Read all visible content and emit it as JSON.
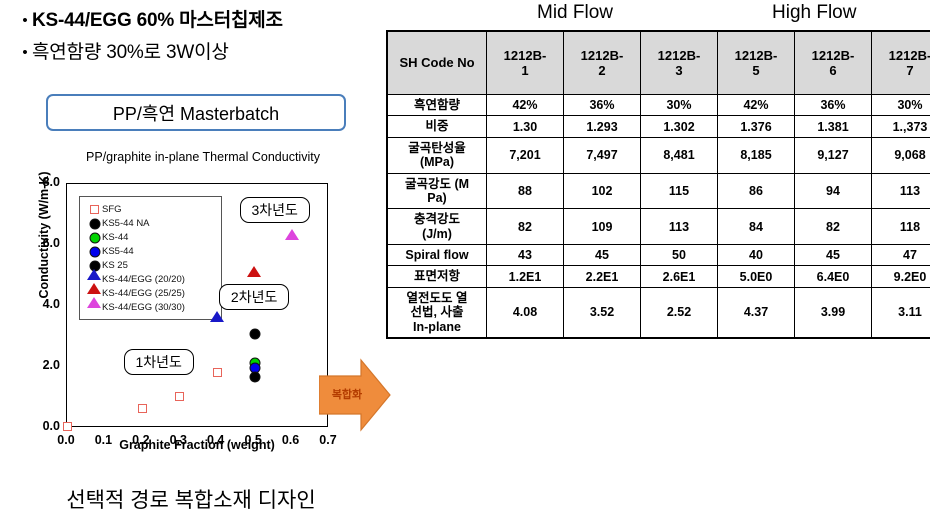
{
  "slide": {
    "bullets": [
      "KS-44/EGG 60% 마스터칩제조",
      "흑연함량 30%로 3W이상"
    ],
    "masterbatch_box": "PP/흑연 Masterbatch",
    "caption": "선택적 경로 복합소재 디자인",
    "arrow_label": "복합화",
    "accent_blue": "#1414cc",
    "box_border_blue": "#4a7ebb",
    "arrow_color": "#ef8c3c",
    "header_bg": "#d9d9d9"
  },
  "chart_data": {
    "type": "scatter",
    "title": "PP/graphite in-plane Thermal Conductivity",
    "xlabel": "Graphite Fraction (weight)",
    "ylabel": "Conductivity (W/m-K)",
    "xlim": [
      0.0,
      0.7
    ],
    "ylim": [
      0.0,
      8.0
    ],
    "xticks": [
      "0.0",
      "0.1",
      "0.2",
      "0.3",
      "0.4",
      "0.5",
      "0.6",
      "0.7"
    ],
    "yticks": [
      "0.0",
      "2.0",
      "4.0",
      "6.0",
      "8.0"
    ],
    "grid": false,
    "legend_position": "top-left",
    "series": [
      {
        "name": "SFG",
        "marker": "open-square",
        "color": "#e8645a",
        "points": [
          [
            0.0,
            0.05
          ],
          [
            0.2,
            0.65
          ],
          [
            0.3,
            1.05
          ],
          [
            0.4,
            1.85
          ]
        ]
      },
      {
        "name": "KS5-44 NA",
        "marker": "circle",
        "color": "#000000",
        "points": [
          [
            0.5,
            3.1
          ]
        ]
      },
      {
        "name": "KS-44",
        "marker": "circle",
        "color": "#00d400",
        "points": [
          [
            0.5,
            2.15
          ]
        ]
      },
      {
        "name": "KS5-44",
        "marker": "circle",
        "color": "#0000ee",
        "points": [
          [
            0.5,
            2.0
          ]
        ]
      },
      {
        "name": "KS 25",
        "marker": "circle",
        "color": "#000000",
        "points": [
          [
            0.5,
            1.72
          ]
        ]
      },
      {
        "name": "KS-44/EGG (20/20)",
        "marker": "triangle",
        "color": "#1818c8",
        "points": [
          [
            0.4,
            3.5
          ]
        ]
      },
      {
        "name": "KS-44/EGG (25/25)",
        "marker": "triangle",
        "color": "#cc1111",
        "points": [
          [
            0.5,
            5.0
          ]
        ]
      },
      {
        "name": "KS-44/EGG (30/30)",
        "marker": "triangle",
        "color": "#dd44dd",
        "points": [
          [
            0.6,
            6.2
          ]
        ]
      }
    ],
    "annotations": [
      {
        "text": "3차년도",
        "x": 0.555,
        "y": 7.15
      },
      {
        "text": "2차년도",
        "x": 0.5,
        "y": 4.3
      },
      {
        "text": "1차년도",
        "x": 0.245,
        "y": 2.15
      }
    ]
  },
  "table": {
    "flow_labels": {
      "mid": "Mid  Flow",
      "high": "High Flow"
    },
    "header": {
      "row_label": "SH Code No",
      "columns": [
        "1212B-\n1",
        "1212B-\n2",
        "1212B-\n3",
        "1212B-\n5",
        "1212B-\n6",
        "1212B-\n7"
      ],
      "highlight_index": 2
    },
    "rows": [
      {
        "label": "흑연함량",
        "values": [
          "42%",
          "36%",
          "30%",
          "42%",
          "36%",
          "30%"
        ]
      },
      {
        "label": "비중",
        "values": [
          "1.30",
          "1.293",
          "1.302",
          "1.376",
          "1.381",
          "1.,373"
        ]
      },
      {
        "label": "굴곡탄성율\n(MPa)",
        "values": [
          "7,201",
          "7,497",
          "8,481",
          "8,185",
          "9,127",
          "9,068"
        ]
      },
      {
        "label": "굴곡강도 (M\nPa)",
        "values": [
          "88",
          "102",
          "115",
          "86",
          "94",
          "113"
        ]
      },
      {
        "label": "충격강도\n(J/m)",
        "values": [
          "82",
          "109",
          "113",
          "84",
          "82",
          "118"
        ]
      },
      {
        "label": "Spiral flow",
        "values": [
          "43",
          "45",
          "50",
          "40",
          "45",
          "47"
        ]
      },
      {
        "label": "표면저항",
        "values": [
          "1.2E1",
          "2.2E1",
          "2.6E1",
          "5.0E0",
          "6.4E0",
          "9.2E0"
        ]
      },
      {
        "label": "열전도도 열\n선법, 사출\nIn-plane",
        "values": [
          "4.08",
          "3.52",
          "2.52",
          "4.37",
          "3.99",
          "3.11"
        ]
      }
    ],
    "highlight_column": 2
  }
}
